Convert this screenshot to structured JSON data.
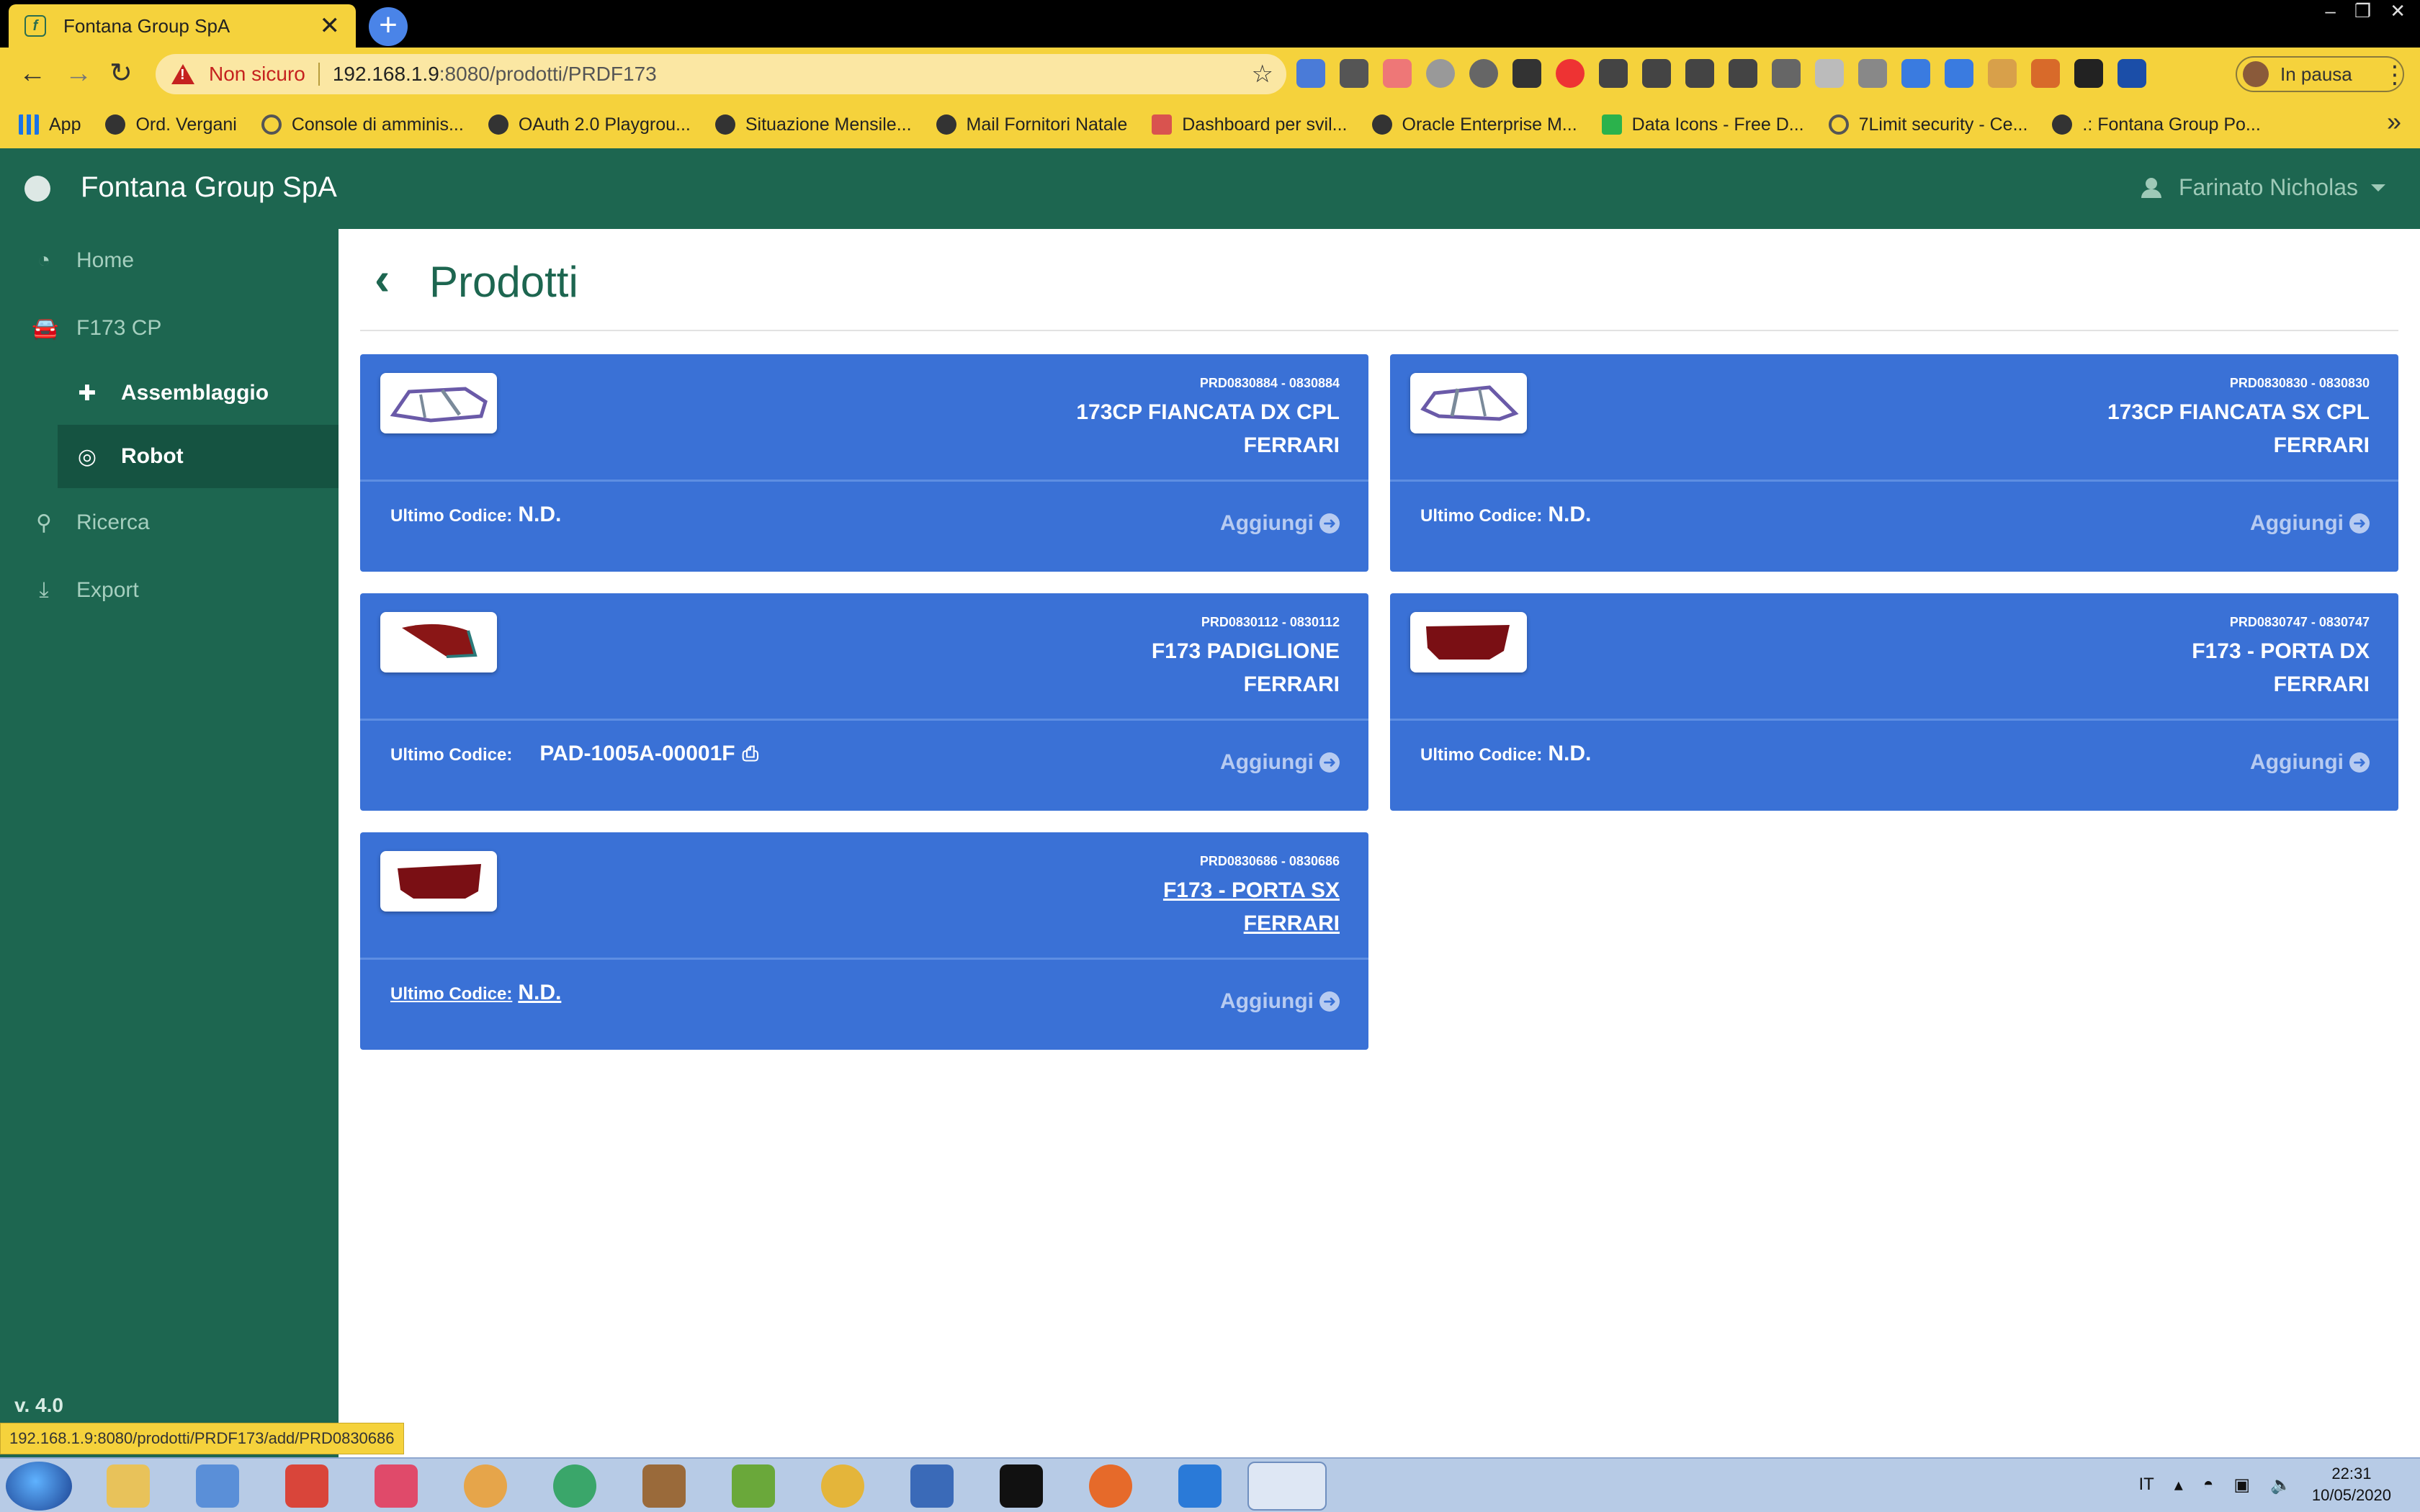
{
  "browser": {
    "tab_title": "Fontana Group SpA",
    "tab_close": "✕",
    "new_tab": "+",
    "insecure_label": "Non sicuro",
    "url_host": "192.168.1.9",
    "url_path": ":8080/prodotti/PRDF173",
    "profile_label": "In pausa",
    "bookmarks": [
      {
        "label": "App",
        "icon": "apps-grid-icon"
      },
      {
        "label": "Ord. Vergani",
        "icon": "globe-icon"
      },
      {
        "label": "Console di amminis...",
        "icon": "google-icon"
      },
      {
        "label": "OAuth 2.0 Playgrou...",
        "icon": "globe-icon"
      },
      {
        "label": "Situazione Mensile...",
        "icon": "globe-icon"
      },
      {
        "label": "Mail Fornitori Natale",
        "icon": "globe-icon"
      },
      {
        "label": "Dashboard per svil...",
        "icon": "dashboard-icon"
      },
      {
        "label": "Oracle Enterprise M...",
        "icon": "globe-icon"
      },
      {
        "label": "Data Icons - Free D...",
        "icon": "data-icons-icon"
      },
      {
        "label": "7Limit security - Ce...",
        "icon": "google-icon"
      },
      {
        "label": ".: Fontana Group Po...",
        "icon": "globe-icon"
      }
    ],
    "status_url": "192.168.1.9:8080/prodotti/PRDF173/add/PRD0830686"
  },
  "app": {
    "title": "Fontana Group SpA",
    "user": "Farinato Nicholas",
    "version": "v. 4.0",
    "nav": [
      {
        "label": "Home",
        "icon": "dashboard-icon"
      },
      {
        "label": "F173 CP",
        "icon": "car-icon"
      },
      {
        "label": "Assemblaggio",
        "icon": "puzzle-icon"
      },
      {
        "label": "Robot",
        "icon": "target-icon"
      },
      {
        "label": "Ricerca",
        "icon": "search-icon"
      },
      {
        "label": "Export",
        "icon": "download-icon"
      }
    ]
  },
  "page": {
    "title": "Prodotti",
    "last_code_label": "Ultimo Codice:",
    "add_label": "Aggiungi",
    "products": [
      {
        "code": "PRD0830884 - 0830884",
        "name": "173CP FIANCATA DX CPL",
        "brand": "FERRARI",
        "last_code": "N.D.",
        "thumb_color": "#7a8a9a"
      },
      {
        "code": "PRD0830830 - 0830830",
        "name": "173CP FIANCATA SX CPL",
        "brand": "FERRARI",
        "last_code": "N.D.",
        "thumb_color": "#7a8a9a"
      },
      {
        "code": "PRD0830112 - 0830112",
        "name": "F173 PADIGLIONE",
        "brand": "FERRARI",
        "last_code": "PAD-1005A-00001F",
        "thumb_color": "#8a1616"
      },
      {
        "code": "PRD0830747 - 0830747",
        "name": "F173 - PORTA DX",
        "brand": "FERRARI",
        "last_code": "N.D.",
        "thumb_color": "#7a0f14"
      },
      {
        "code": "PRD0830686 - 0830686",
        "name": "F173 - PORTA SX",
        "brand": "FERRARI",
        "last_code": "N.D.",
        "thumb_color": "#7a0f14"
      }
    ]
  },
  "taskbar": {
    "lang": "IT",
    "time": "22:31",
    "date": "10/05/2020"
  }
}
